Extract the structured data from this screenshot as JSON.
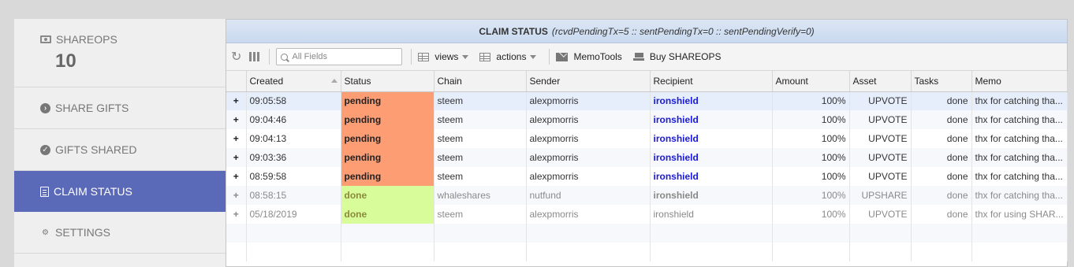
{
  "sidebar": {
    "stat": {
      "label": "SHAREOPS",
      "value": "10",
      "icon": "money-icon"
    },
    "items": [
      {
        "label": "SHARE GIFTS",
        "icon": "arrow-circle-right-icon",
        "active": false
      },
      {
        "label": "GIFTS SHARED",
        "icon": "check-circle-icon",
        "active": false
      },
      {
        "label": "CLAIM STATUS",
        "icon": "document-icon",
        "active": true
      },
      {
        "label": "SETTINGS",
        "icon": "gears-icon",
        "active": false
      }
    ]
  },
  "panel": {
    "title": "CLAIM STATUS",
    "subtitle": "(rcvdPendingTx=5 :: sentPendingTx=0 :: sentPendingVerify=0)"
  },
  "toolbar": {
    "search_placeholder": "All Fields",
    "views_label": "views",
    "actions_label": "actions",
    "memotools_label": "MemoTools",
    "buy_label": "Buy SHAREOPS"
  },
  "table": {
    "columns": [
      "Created",
      "Status",
      "Chain",
      "Sender",
      "Recipient",
      "Amount",
      "Asset",
      "Tasks",
      "Memo"
    ],
    "rows": [
      {
        "expand": "+",
        "created": "09:05:58",
        "status": "pending",
        "chain": "steem",
        "sender": "alexpmorris",
        "recipient": "ironshield",
        "amount": "100%",
        "asset": "UPVOTE",
        "tasks": "done",
        "memo": "thx for catching tha..."
      },
      {
        "expand": "+",
        "created": "09:04:46",
        "status": "pending",
        "chain": "steem",
        "sender": "alexpmorris",
        "recipient": "ironshield",
        "amount": "100%",
        "asset": "UPVOTE",
        "tasks": "done",
        "memo": "thx for catching tha..."
      },
      {
        "expand": "+",
        "created": "09:04:13",
        "status": "pending",
        "chain": "steem",
        "sender": "alexpmorris",
        "recipient": "ironshield",
        "amount": "100%",
        "asset": "UPVOTE",
        "tasks": "done",
        "memo": "thx for catching tha..."
      },
      {
        "expand": "+",
        "created": "09:03:36",
        "status": "pending",
        "chain": "steem",
        "sender": "alexpmorris",
        "recipient": "ironshield",
        "amount": "100%",
        "asset": "UPVOTE",
        "tasks": "done",
        "memo": "thx for catching tha..."
      },
      {
        "expand": "+",
        "created": "08:59:58",
        "status": "pending",
        "chain": "steem",
        "sender": "alexpmorris",
        "recipient": "ironshield",
        "amount": "100%",
        "asset": "UPVOTE",
        "tasks": "done",
        "memo": "thx for catching tha..."
      },
      {
        "expand": "+",
        "created": "08:58:15",
        "status": "done",
        "chain": "whaleshares",
        "sender": "nutfund",
        "recipient": "ironshield",
        "amount": "100%",
        "asset": "UPSHARE",
        "tasks": "done",
        "memo": "thx for catching tha..."
      },
      {
        "expand": "+",
        "created": "05/18/2019",
        "status": "done",
        "chain": "steem",
        "sender": "alexpmorris",
        "recipient": "ironshield",
        "amount": "100%",
        "asset": "UPVOTE",
        "tasks": "done",
        "memo": "thx for using SHAR..."
      }
    ]
  },
  "colors": {
    "active_sidebar": "#5a6ab8",
    "pending": "#fd9d74",
    "done": "#d9fc9b",
    "recipient_link": "#1a1adb"
  }
}
